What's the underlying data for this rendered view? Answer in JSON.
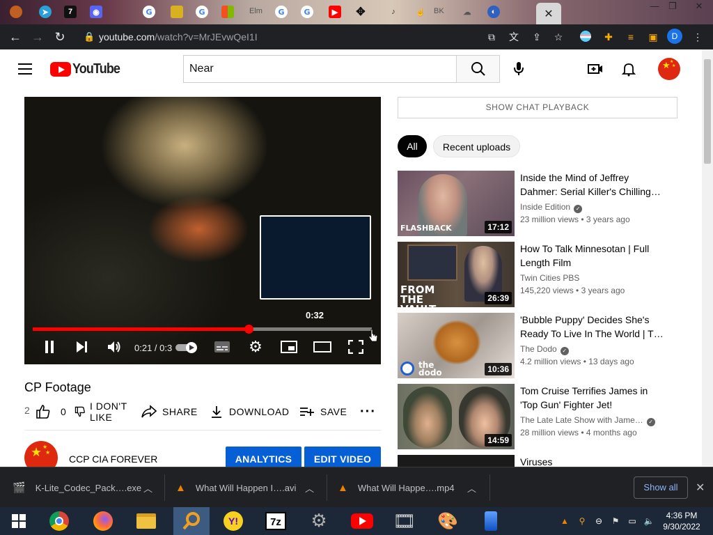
{
  "browser": {
    "url_host": "youtube.com",
    "url_path": "/watch?v=MrJEvwQeI1I",
    "tabs": [
      "Elm",
      "BK"
    ],
    "close_tab": "✕",
    "profile_initial": "D"
  },
  "youtube": {
    "logo": "YouTube",
    "search_value": "Near"
  },
  "player": {
    "preview_time": "0:32",
    "time_display": "0:21 / 0:3",
    "progress_fraction": 0.637
  },
  "video": {
    "title": "CP Footage",
    "like_prefix": "2",
    "likes": "0",
    "dislike_label": "I DON'T LIKE",
    "share_label": "SHARE",
    "download_label": "DOWNLOAD",
    "save_label": "SAVE",
    "channel_name": "CCP CIA FOREVER",
    "analytics_label": "ANALYTICS",
    "edit_label": "EDIT VIDEO"
  },
  "sidebar": {
    "chat_button": "SHOW CHAT PLAYBACK",
    "chips": [
      "All",
      "Recent uploads"
    ],
    "recommendations": [
      {
        "title": "Inside the Mind of Jeffrey Dahmer: Serial Killer's Chilling…",
        "channel": "Inside Edition",
        "verified": true,
        "views": "23 million views",
        "age": "3 years ago",
        "duration": "17:12",
        "thumb_text": "FLASHBACK"
      },
      {
        "title": "How To Talk Minnesotan | Full Length Film",
        "channel": "Twin Cities PBS",
        "verified": false,
        "views": "145,220 views",
        "age": "3 years ago",
        "duration": "26:39",
        "thumb_text": "FROM THE VAULT"
      },
      {
        "title": "'Bubble Puppy' Decides She's Ready To Live In The World | T…",
        "channel": "The Dodo",
        "verified": true,
        "views": "4.2 million views",
        "age": "13 days ago",
        "duration": "10:36",
        "thumb_text": "the dodo"
      },
      {
        "title": "Tom Cruise Terrifies James in 'Top Gun' Fighter Jet!",
        "channel": "The Late Late Show with Jame…",
        "verified": true,
        "views": "28 million views",
        "age": "4 months ago",
        "duration": "14:59",
        "thumb_text": ""
      },
      {
        "title": "Viruses",
        "channel": "",
        "verified": false,
        "views": "",
        "age": "",
        "duration": "",
        "thumb_text": ""
      }
    ]
  },
  "downloads": {
    "items": [
      "K-Lite_Codec_Pack….exe",
      "What Will Happen I….avi",
      "What Will Happe….mp4"
    ],
    "show_all": "Show all"
  },
  "taskbar": {
    "time": "4:36 PM",
    "date": "9/30/2022"
  }
}
